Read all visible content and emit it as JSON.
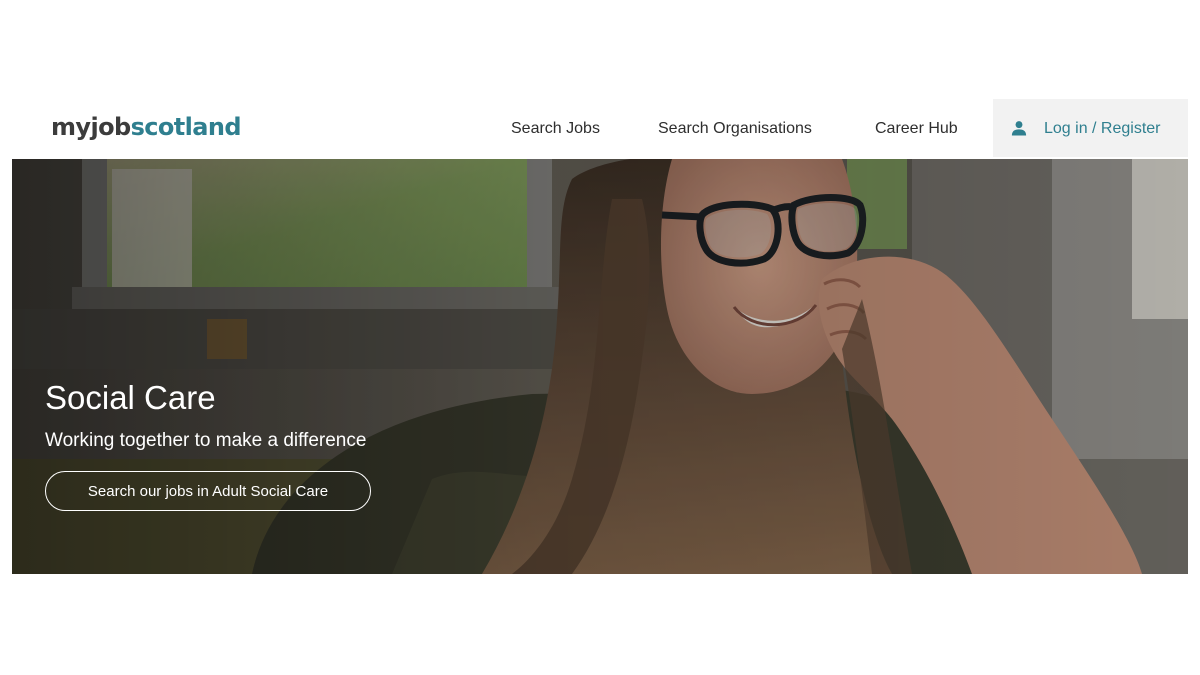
{
  "header": {
    "logo": {
      "part1": "myjob",
      "part2": "scotland"
    },
    "nav": {
      "search_jobs": "Search Jobs",
      "search_organisations": "Search Organisations",
      "career_hub": "Career Hub"
    },
    "login": {
      "label": "Log in / Register",
      "icon": "person-icon"
    }
  },
  "hero": {
    "title": "Social Care",
    "subtitle": "Working together to make a difference",
    "button_label": "Search our jobs in Adult Social Care",
    "image": "photo of a smiling woman with glasses resting her chin on her hand by a window"
  },
  "colors": {
    "brand_teal": "#2f7f8f",
    "logo_dark": "#3c3c3c",
    "nav_text": "#2e2e2e",
    "login_bg": "#f2f2f2",
    "hero_text": "#ffffff"
  }
}
